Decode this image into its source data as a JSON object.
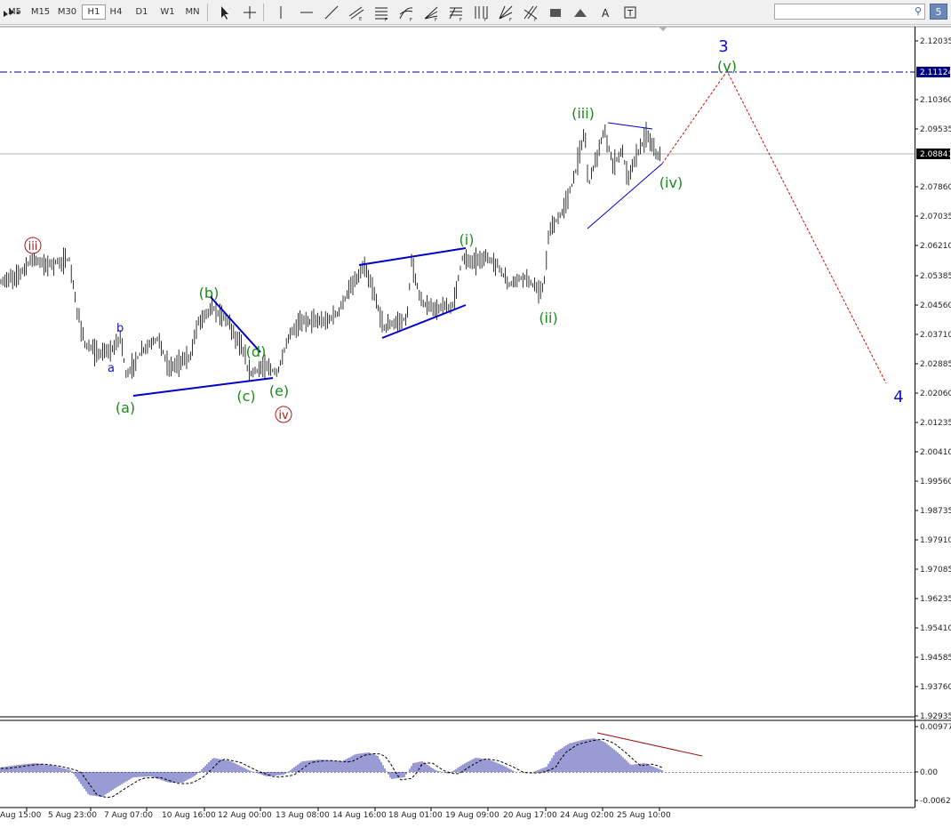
{
  "toolbar": {
    "timeframes": [
      "M5",
      "M15",
      "M30",
      "H1",
      "H4",
      "D1",
      "W1",
      "MN"
    ],
    "active_timeframe": "H1",
    "tools": [
      "cursor-icon",
      "crosshair-icon",
      "vertical-line-icon",
      "horizontal-line-icon",
      "trendline-icon",
      "equidistant-channel-icon",
      "fibonacci-retracement-icon",
      "fibonacci-arcs-icon",
      "fibonacci-fan-icon",
      "fibonacci-expansion-icon",
      "fibonacci-timezones-icon",
      "gann-fan-icon",
      "gann-grid-icon",
      "rectangle-icon",
      "triangle-icon",
      "text-icon",
      "text-label-icon",
      "arrows-menu-icon"
    ],
    "search_placeholder": "",
    "badge": "5"
  },
  "chart_data": {
    "type": "line",
    "symbol_timeframe": "H1",
    "price_axis": [
      "2.12035",
      "2.11124",
      "2.10360",
      "2.09535",
      "2.08841",
      "2.07860",
      "2.07035",
      "2.06210",
      "2.05385",
      "2.04560",
      "2.03710",
      "2.02885",
      "2.02060",
      "2.01235",
      "2.00410",
      "1.99560",
      "1.98735",
      "1.97910",
      "1.97085",
      "1.96235",
      "1.95410",
      "1.94585",
      "1.93760",
      "1.92935"
    ],
    "current_price": "2.08841",
    "target_line_price": "2.11124",
    "time_axis": [
      "Aug 15:00",
      "5 Aug 23:00",
      "7 Aug 07:00",
      "10 Aug 16:00",
      "12 Aug 00:00",
      "13 Aug 08:00",
      "14 Aug 16:00",
      "18 Aug 01:00",
      "19 Aug 09:00",
      "20 Aug 17:00",
      "24 Aug 02:00",
      "25 Aug 10:00"
    ],
    "indicator_axis": [
      "0.009778",
      "0.00",
      "-0.00627"
    ],
    "wave_labels": {
      "iii_circle": "iii",
      "iv_circle": "iv",
      "a_small": "a",
      "b_small": "b",
      "a_paren": "(a)",
      "b_paren": "(b)",
      "c_paren": "(c)",
      "d_paren": "(d)",
      "e_paren": "(e)",
      "i_paren": "(i)",
      "ii_paren": "(ii)",
      "iii_paren": "(iii)",
      "iv_paren": "(iv)",
      "v_paren": "(v)",
      "wave3": "3",
      "wave4": "4"
    },
    "colors": {
      "bars": "#000000",
      "trendlines": "#0000c8",
      "green_labels": "#1a8a1a",
      "red_labels": "#b01818",
      "blue_labels": "#1010c0",
      "projection": "#c01010",
      "histogram": "#2020a0",
      "target_line": "#000080"
    },
    "grid": false
  }
}
